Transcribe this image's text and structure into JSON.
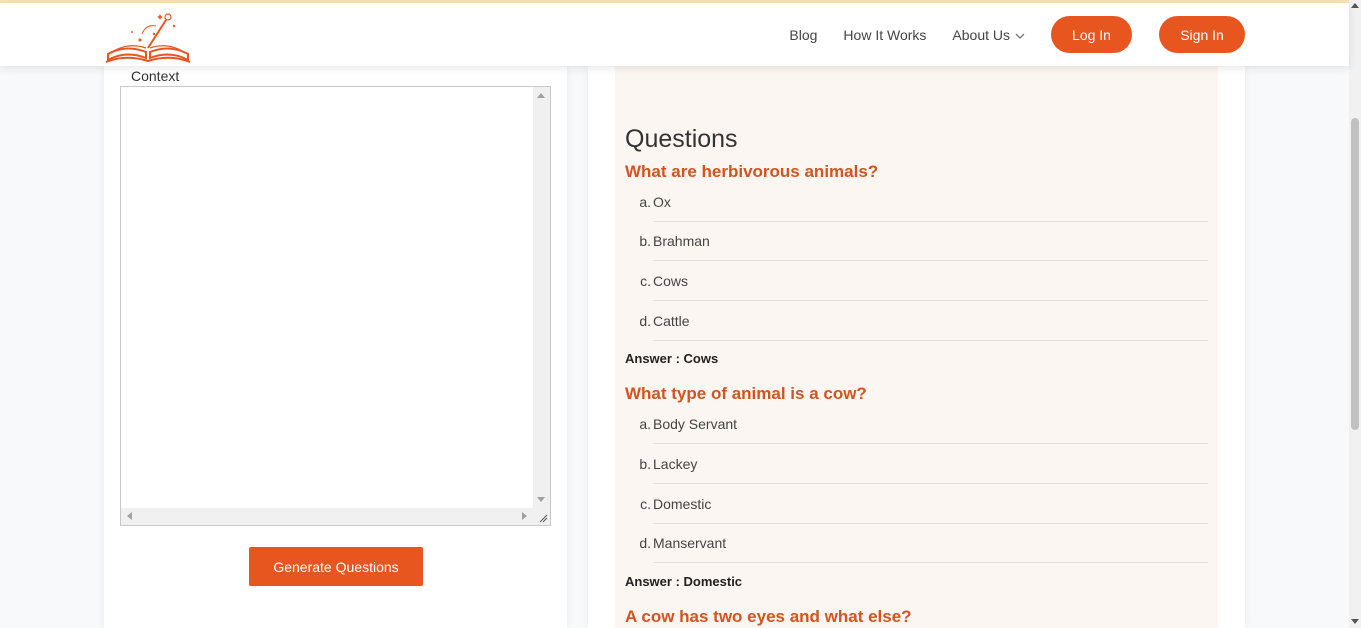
{
  "colors": {
    "brand": "#e8561f",
    "question": "#d2541e",
    "panel": "#fbf6f2"
  },
  "header": {
    "logo_icon": "open-book-magic-wand-icon",
    "nav": [
      {
        "label": "Blog"
      },
      {
        "label": "How It Works"
      },
      {
        "label": "About Us"
      }
    ],
    "login_label": "Log In",
    "signin_label": "Sign In"
  },
  "left": {
    "context_label": "Context",
    "context_value": "",
    "generate_label": "Generate Questions"
  },
  "right": {
    "heading": "Questions",
    "questions": [
      {
        "title": "What are herbivorous animals?",
        "options": [
          {
            "letter": "a.",
            "text": "Ox"
          },
          {
            "letter": "b.",
            "text": "Brahman"
          },
          {
            "letter": "c.",
            "text": "Cows"
          },
          {
            "letter": "d.",
            "text": "Cattle"
          }
        ],
        "answer": "Answer : Cows"
      },
      {
        "title": "What type of animal is a cow?",
        "options": [
          {
            "letter": "a.",
            "text": "Body Servant"
          },
          {
            "letter": "b.",
            "text": "Lackey"
          },
          {
            "letter": "c.",
            "text": "Domestic"
          },
          {
            "letter": "d.",
            "text": "Manservant"
          }
        ],
        "answer": "Answer : Domestic"
      },
      {
        "title": "A cow has two eyes and what else?"
      }
    ]
  }
}
